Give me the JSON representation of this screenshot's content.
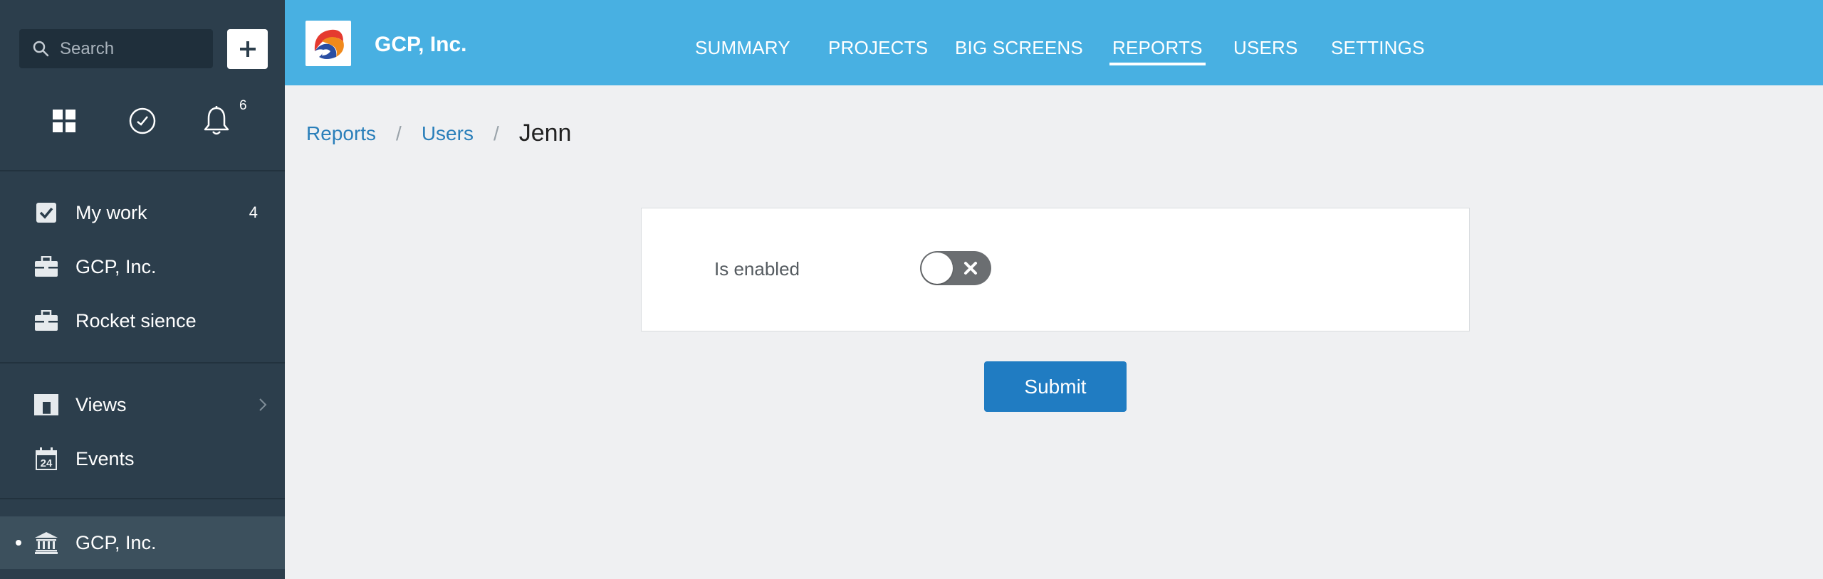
{
  "sidebar": {
    "search_placeholder": "Search",
    "notification_count": "6",
    "items": [
      {
        "label": "My work",
        "count": "4",
        "icon": "checkbox-icon"
      },
      {
        "label": "GCP, Inc.",
        "icon": "briefcase-icon"
      },
      {
        "label": "Rocket sience",
        "icon": "briefcase-icon"
      },
      {
        "label": "Views",
        "icon": "views-icon"
      },
      {
        "label": "Events",
        "icon": "calendar-icon",
        "icon_text": "24"
      },
      {
        "label": "GCP, Inc.",
        "icon": "bank-icon",
        "active": true
      }
    ]
  },
  "header": {
    "company": "GCP, Inc.",
    "nav": [
      "SUMMARY",
      "PROJECTS",
      "BIG SCREENS",
      "REPORTS",
      "USERS",
      "SETTINGS"
    ],
    "active_nav": "REPORTS"
  },
  "breadcrumb": {
    "items": [
      "Reports",
      "Users"
    ],
    "current": "Jenn"
  },
  "form": {
    "enabled_label": "Is enabled",
    "enabled_value": false,
    "submit_label": "Submit"
  },
  "colors": {
    "sidebar_bg": "#2c3e4c",
    "topbar_bg": "#48b0e2",
    "primary_button": "#207cc2",
    "link": "#2a7fba"
  }
}
